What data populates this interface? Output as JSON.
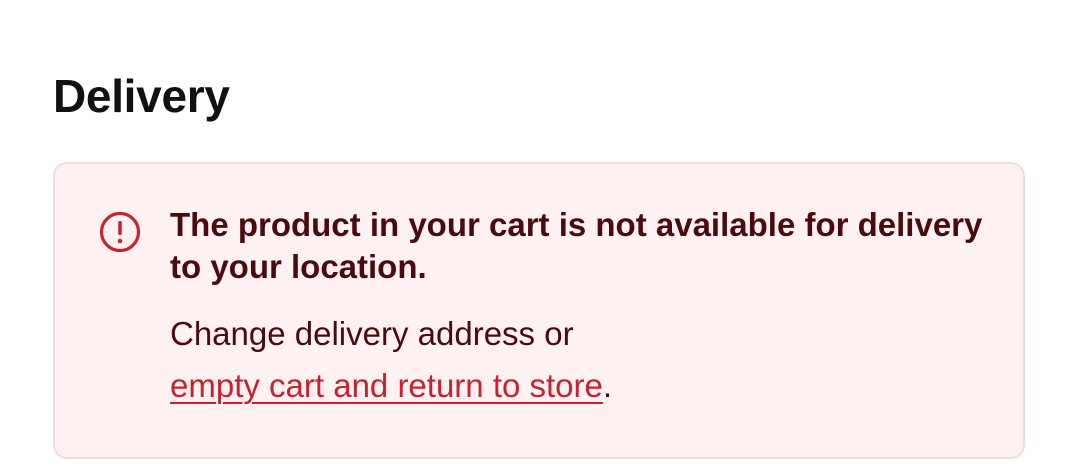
{
  "section": {
    "title": "Delivery"
  },
  "alert": {
    "icon": "exclamation-circle-icon",
    "title": "The product in your cart is not available for delivery to your location.",
    "message_prefix": "Change delivery address or",
    "link_label": "empty cart and return to store",
    "message_suffix": "."
  },
  "colors": {
    "alert_background": "#fdf1f2",
    "alert_border": "#f7d9dc",
    "alert_text": "#4a0a0e",
    "link": "#c8222f",
    "icon": "#c8222f"
  }
}
